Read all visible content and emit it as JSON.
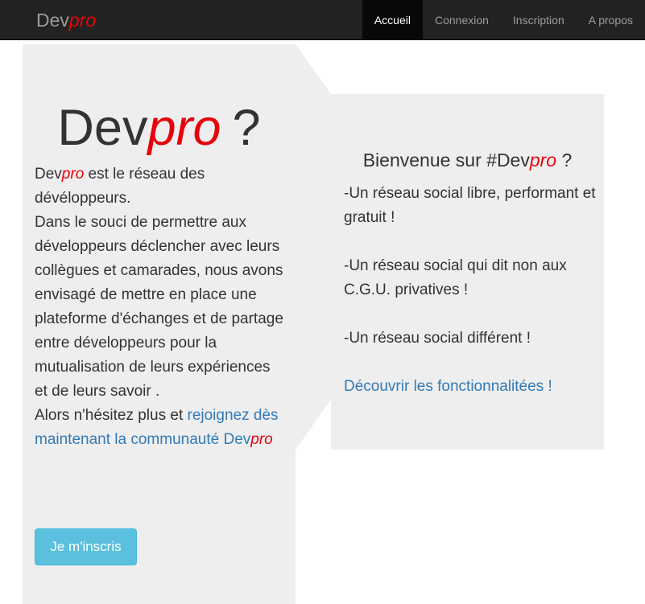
{
  "brand": {
    "dev": "Dev",
    "pro": "pro"
  },
  "nav": [
    {
      "label": "Accueil",
      "active": true
    },
    {
      "label": "Connexion"
    },
    {
      "label": "Inscription"
    },
    {
      "label": "A propos"
    }
  ],
  "hero": {
    "title_dev": "Dev",
    "title_pro": "pro",
    "title_q": "?"
  },
  "intro": {
    "dev": "Dev",
    "pro": "pro",
    "text1": " est le réseau des dévéloppeurs.",
    "text2": "Dans le souci de permettre aux développeurs déclencher avec leurs collègues et camarades, nous avons envisagé de mettre en place une plateforme d'échanges et de partage entre développeurs pour la mutualisation de leurs expériences et de leurs savoir .",
    "text3": "Alors n'hésitez plus et ",
    "link": "rejoignez dès maintenant la communauté Dev",
    "link_pro": "pro"
  },
  "signup_button": "Je m'inscris",
  "welcome": {
    "prefix": "Bienvenue sur #Dev",
    "pro": "pro",
    "suffix": " ?"
  },
  "features": [
    "-Un réseau social libre, performant et gratuit !",
    "-Un réseau social qui dit non aux C.G.U. privatives !",
    "-Un réseau social différent !"
  ],
  "features_link": "Découvrir les fonctionnalitées !",
  "colors": {
    "navbar": "#222222",
    "accent_red": "#e8000b",
    "link": "#337ab7",
    "button": "#5bc0de",
    "panel": "#eeeeee"
  }
}
